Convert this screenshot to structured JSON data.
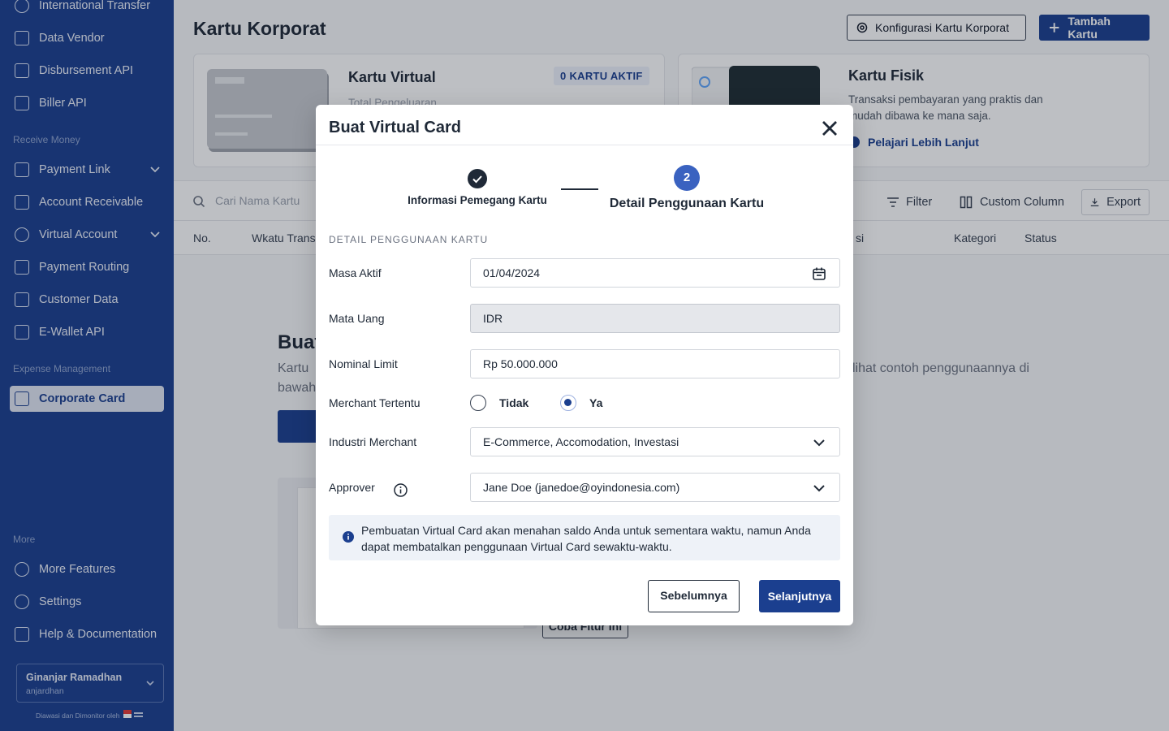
{
  "sidebar": {
    "items": [
      {
        "label": "International Transfer"
      },
      {
        "label": "Data Vendor"
      },
      {
        "label": "Disbursement API"
      },
      {
        "label": "Biller API"
      },
      {
        "label": "Payment Link"
      },
      {
        "label": "Account Receivable"
      },
      {
        "label": "Virtual Account"
      },
      {
        "label": "Payment Routing"
      },
      {
        "label": "Customer Data"
      },
      {
        "label": "E-Wallet API"
      },
      {
        "label": "Corporate Card"
      },
      {
        "label": "More Features"
      },
      {
        "label": "Settings"
      },
      {
        "label": "Help & Documentation"
      }
    ],
    "sections": {
      "receive_money": "Receive Money",
      "expense_management": "Expense Management",
      "more": "More"
    },
    "user": {
      "name": "Ginanjar Ramadhan",
      "handle": "anjardhan"
    },
    "supervised_text": "Diawasi dan Dimonitor oleh"
  },
  "main": {
    "title": "Kartu Korporat",
    "config_button": "Konfigurasi Kartu Korporat",
    "add_button": "Tambah Kartu",
    "virtual_card": {
      "title": "Kartu Virtual",
      "badge": "0 KARTU AKTIF",
      "subtitle": "Total Pengeluaran"
    },
    "physical_card": {
      "title": "Kartu Fisik",
      "description": "Transaksi pembayaran yang praktis dan mudah dibawa ke mana saja.",
      "link": "Pelajari Lebih Lanjut"
    },
    "toolbar": {
      "search_placeholder": "Cari Nama Kartu",
      "filter": "Filter",
      "custom_column": "Custom Column",
      "export": "Export"
    },
    "table_headers": {
      "no": "No.",
      "time": "Wkatu Trans",
      "transaction": "si",
      "category": "Kategori",
      "status": "Status"
    },
    "empty": {
      "title": "Buat",
      "desc_line1": "Kartu",
      "desc_right": "lihat contoh penggunaannya di",
      "desc_line2": "bawah"
    },
    "try_button": "Coba Fitur Ini"
  },
  "modal": {
    "title": "Buat Virtual Card",
    "steps": [
      {
        "label": "Informasi Pemegang Kartu"
      },
      {
        "number": "2",
        "label": "Detail Penggunaan Kartu"
      }
    ],
    "section_heading": "DETAIL PENGGUNAAN KARTU",
    "fields": {
      "masa_aktif": {
        "label": "Masa Aktif",
        "value": "01/04/2024"
      },
      "mata_uang": {
        "label": "Mata Uang",
        "value": "IDR"
      },
      "nominal_limit": {
        "label": "Nominal Limit",
        "value": "Rp 50.000.000"
      },
      "merchant_tertentu": {
        "label": "Merchant Tertentu",
        "option_no": "Tidak",
        "option_yes": "Ya"
      },
      "industri_merchant": {
        "label": "Industri Merchant",
        "value": "E-Commerce, Accomodation, Investasi"
      },
      "approver": {
        "label": "Approver",
        "value": "Jane Doe (janedoe@oyindonesia.com)"
      }
    },
    "info_text": "Pembuatan Virtual Card akan menahan saldo Anda untuk sementara waktu, namun Anda dapat membatalkan penggunaan Virtual Card sewaktu-waktu.",
    "prev_button": "Sebelumnya",
    "next_button": "Selanjutnya"
  },
  "colors": {
    "primary": "#1b3f8f",
    "step_active": "#3a62c0"
  }
}
